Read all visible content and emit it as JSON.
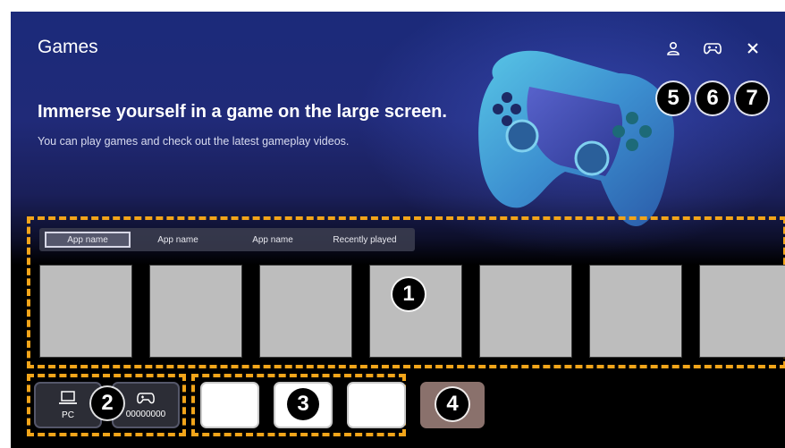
{
  "header": {
    "title": "Games",
    "headline": "Immerse yourself in a game on the large screen.",
    "subline": "You can play games and check out the latest gameplay videos."
  },
  "top_icons": [
    "profile-icon",
    "gamepad-icon",
    "close-icon"
  ],
  "tabs": [
    {
      "label": "App name",
      "active": true
    },
    {
      "label": "App name",
      "active": false
    },
    {
      "label": "App name",
      "active": false
    },
    {
      "label": "Recently played",
      "active": false
    }
  ],
  "devices": [
    {
      "icon": "laptop-icon",
      "label": "PC"
    },
    {
      "icon": "gamepad-icon",
      "label": "00000000"
    }
  ],
  "callouts": {
    "c1": "1",
    "c2": "2",
    "c3": "3",
    "c4": "4",
    "c5": "5",
    "c6": "6",
    "c7": "7"
  },
  "colors": {
    "accent_dash": "#f2a51a",
    "card_placeholder": "#bdbdbd",
    "brown_button": "#8a716c"
  }
}
